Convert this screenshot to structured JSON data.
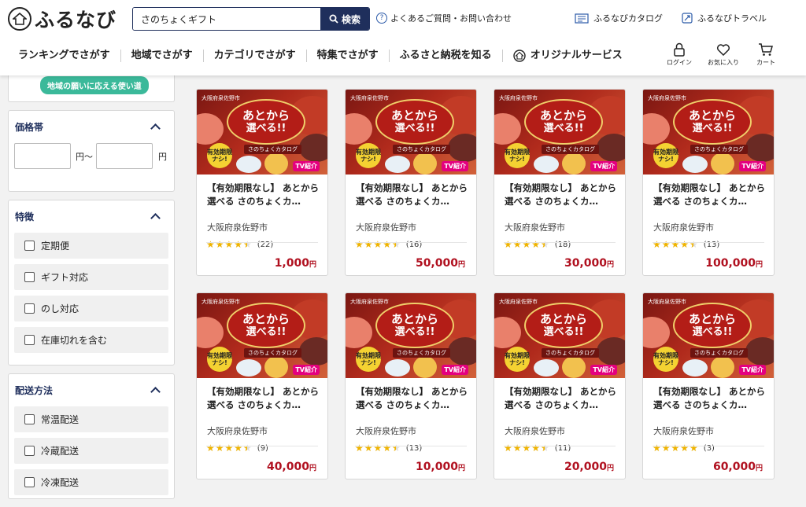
{
  "header": {
    "logo_text": "ふるなび",
    "search_value": "さのちょくギフト",
    "search_button": "検索",
    "faq_link": "よくあるご質問・お問い合わせ",
    "catalog_link": "ふるなびカタログ",
    "travel_link": "ふるなびトラベル"
  },
  "nav": {
    "items": [
      "ランキングでさがす",
      "地域でさがす",
      "カテゴリでさがす",
      "特集でさがす",
      "ふるさと納税を知る",
      "オリジナルサービス"
    ],
    "login": "ログイン",
    "favorite": "お気に入り",
    "cart": "カート"
  },
  "sidebar": {
    "region_tag": "地域の願いに応える使い道",
    "price": {
      "title": "価格帯",
      "from_unit": "円〜",
      "to_unit": "円"
    },
    "features": {
      "title": "特徴",
      "options": [
        "定期便",
        "ギフト対応",
        "のし対応",
        "在庫切れを含む"
      ]
    },
    "delivery": {
      "title": "配送方法",
      "options": [
        "常温配送",
        "冷蔵配送",
        "冷凍配送"
      ]
    }
  },
  "banner": {
    "city_badge": "大阪府泉佐野市",
    "headline_1": "あとから",
    "headline_2": "選べる!!",
    "catalog_label": "さのちょくカタログ",
    "no_expiry_1": "有効期限",
    "no_expiry_2": "ナシ!",
    "tv_badge": "TV紹介"
  },
  "products": [
    {
      "title": "【有効期限なし】 あとから選べる さのちょくカ…",
      "city": "大阪府泉佐野市",
      "rating": 4.4,
      "reviews": "(22)",
      "price": "1,000",
      "yen": "円"
    },
    {
      "title": "【有効期限なし】 あとから選べる さのちょくカ…",
      "city": "大阪府泉佐野市",
      "rating": 4.4,
      "reviews": "(16)",
      "price": "50,000",
      "yen": "円"
    },
    {
      "title": "【有効期限なし】 あとから選べる さのちょくカ…",
      "city": "大阪府泉佐野市",
      "rating": 4.4,
      "reviews": "(18)",
      "price": "30,000",
      "yen": "円"
    },
    {
      "title": "【有効期限なし】 あとから選べる さのちょくカ…",
      "city": "大阪府泉佐野市",
      "rating": 4.4,
      "reviews": "(13)",
      "price": "100,000",
      "yen": "円"
    },
    {
      "title": "【有効期限なし】 あとから選べる さのちょくカ…",
      "city": "大阪府泉佐野市",
      "rating": 4.4,
      "reviews": "(9)",
      "price": "40,000",
      "yen": "円"
    },
    {
      "title": "【有効期限なし】 あとから選べる さのちょくカ…",
      "city": "大阪府泉佐野市",
      "rating": 4.4,
      "reviews": "(13)",
      "price": "10,000",
      "yen": "円"
    },
    {
      "title": "【有効期限なし】 あとから選べる さのちょくカ…",
      "city": "大阪府泉佐野市",
      "rating": 4.4,
      "reviews": "(11)",
      "price": "20,000",
      "yen": "円"
    },
    {
      "title": "【有効期限なし】 あとから選べる さのちょくカ…",
      "city": "大阪府泉佐野市",
      "rating": 5.0,
      "reviews": "(3)",
      "price": "60,000",
      "yen": "円"
    }
  ],
  "colors": {
    "navy": "#1f2f5c",
    "price": "#b0101f",
    "star": "#f0b400",
    "tag": "#3bb99a"
  }
}
